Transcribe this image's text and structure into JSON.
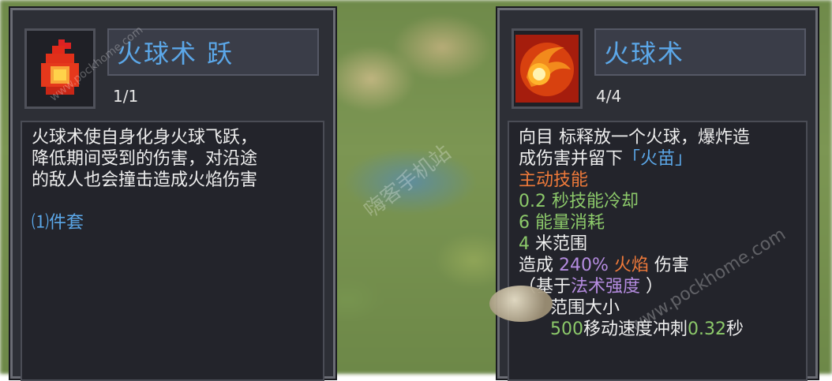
{
  "left_card": {
    "title": "火球术 跃",
    "level": "1/1",
    "description": [
      "火球术使自身化身火球飞跃，",
      "降低期间受到的伤害，对沿途",
      "的敌人也会撞击造成火焰伤害"
    ],
    "set_label": "⑴件套",
    "icon": "fire-drop-icon"
  },
  "right_card": {
    "title": "火球术",
    "level": "4/4",
    "icon": "fireball-swirl-icon",
    "desc_line1": "向目 标释放一个火球，爆炸造",
    "desc_line2_a": "成伤害并留下",
    "desc_line2_b": "「火苗」",
    "active_skill": "主动技能",
    "cooldown_value": "0.2",
    "cooldown_text": " 秒技能冷却",
    "energy_value": "6",
    "energy_text": " 能量消耗",
    "range_value": "4",
    "range_text": " 米范围",
    "damage_prefix": "造成 ",
    "damage_pct": "240%",
    "damage_type": " 火焰",
    "damage_suffix": " 伤害",
    "based_prefix": "（基于",
    "based_stat": "法术强度",
    "based_suffix": " ）",
    "range_size": "范围大小",
    "dash_prefix": "500",
    "dash_text": "移动速度冲刺",
    "dash_time": "0.32",
    "dash_unit": "秒"
  },
  "watermarks": [
    "www.pockhome.com",
    "嗨客手机站",
    "www.pockhome.com"
  ],
  "colors": {
    "title_blue": "#5ba7e8",
    "skill_orange": "#f07a3a",
    "stat_green": "#8cc96a",
    "stat_purple": "#b58ce0"
  }
}
